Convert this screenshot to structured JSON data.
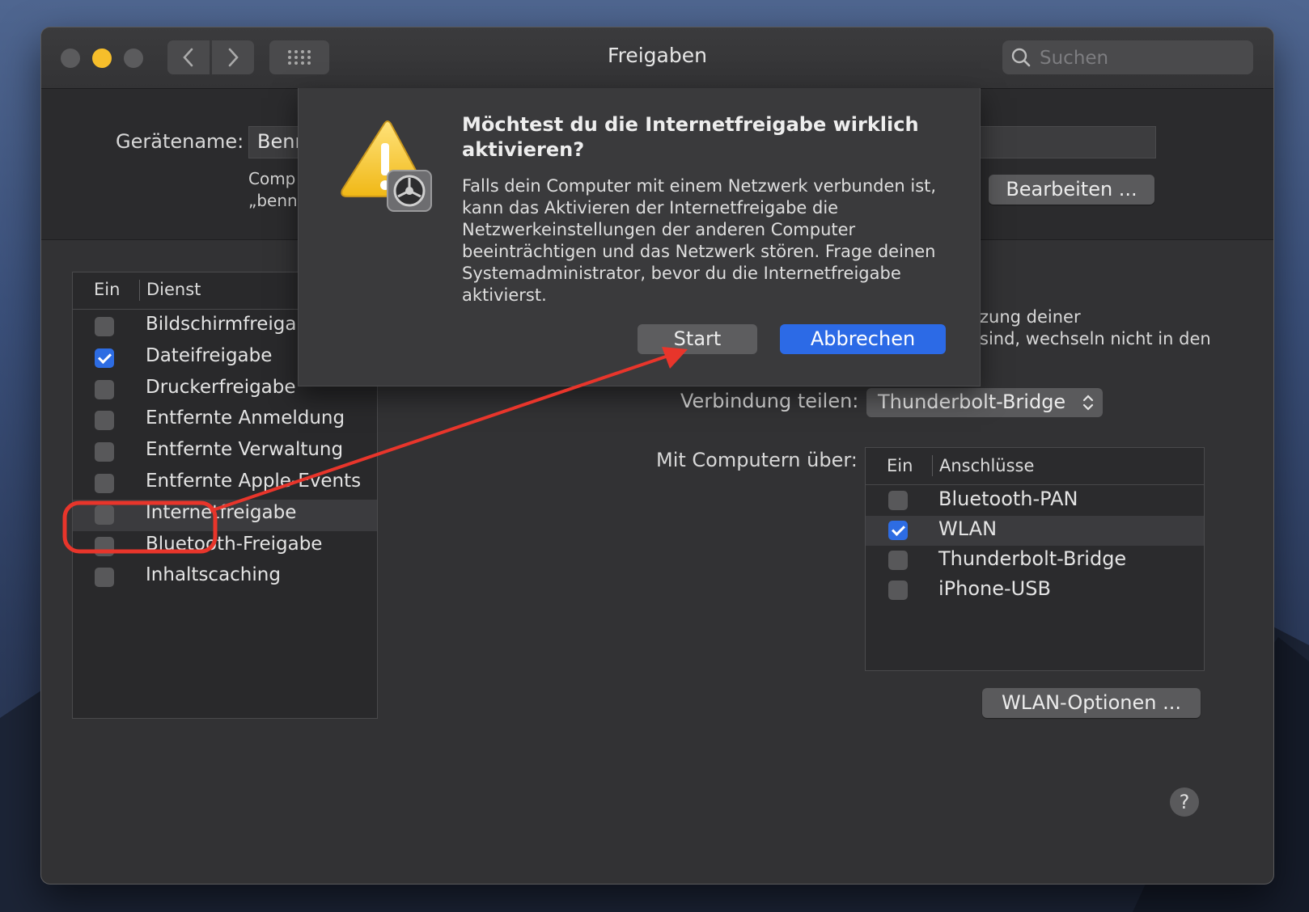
{
  "window": {
    "title": "Freigaben",
    "search_placeholder": "Suchen"
  },
  "device": {
    "name_label": "Gerätename:",
    "name_value": "Benn",
    "sub_line_1": "Comp",
    "sub_line_2": "„benn",
    "edit_button": "Bearbeiten ..."
  },
  "services": {
    "header_on": "Ein",
    "header_service": "Dienst",
    "items": [
      {
        "label": "Bildschirmfreigab",
        "checked": false
      },
      {
        "label": "Dateifreigabe",
        "checked": true
      },
      {
        "label": "Druckerfreigabe",
        "checked": false
      },
      {
        "label": "Entfernte Anmeldung",
        "checked": false
      },
      {
        "label": "Entfernte Verwaltung",
        "checked": false
      },
      {
        "label": "Entfernte Apple-Events",
        "checked": false
      },
      {
        "label": "Internetfreigabe",
        "checked": false,
        "selected": true
      },
      {
        "label": "Bluetooth-Freigabe",
        "checked": false
      },
      {
        "label": "Inhaltscaching",
        "checked": false
      }
    ]
  },
  "detail": {
    "desc_line_1": "zung deiner",
    "desc_line_2": "sind, wechseln nicht in den",
    "share_label": "Verbindung teilen:",
    "share_value": "Thunderbolt-Bridge",
    "computers_label": "Mit Computern über:",
    "ports_header_on": "Ein",
    "ports_header_name": "Anschlüsse",
    "ports": [
      {
        "label": "Bluetooth-PAN",
        "checked": false
      },
      {
        "label": "WLAN",
        "checked": true,
        "selected": true
      },
      {
        "label": "Thunderbolt-Bridge",
        "checked": false
      },
      {
        "label": "iPhone-USB",
        "checked": false
      }
    ],
    "wlan_button": "WLAN-Optionen ...",
    "help": "?"
  },
  "dialog": {
    "title": "Möchtest du die Internetfreigabe wirklich aktivieren?",
    "body": "Falls dein Computer mit einem Netzwerk verbunden ist, kann das Aktivieren der Internetfreigabe die Netzwerkeinstellungen der anderen Computer beeinträchtigen und das Netzwerk stören. Frage deinen Systemadministrator, bevor du die Internetfreigabe aktivierst.",
    "start_button": "Start",
    "cancel_button": "Abbrechen"
  },
  "colors": {
    "accent": "#2c6ae6",
    "annotation": "#e8352b",
    "window_bg": "#323234"
  }
}
